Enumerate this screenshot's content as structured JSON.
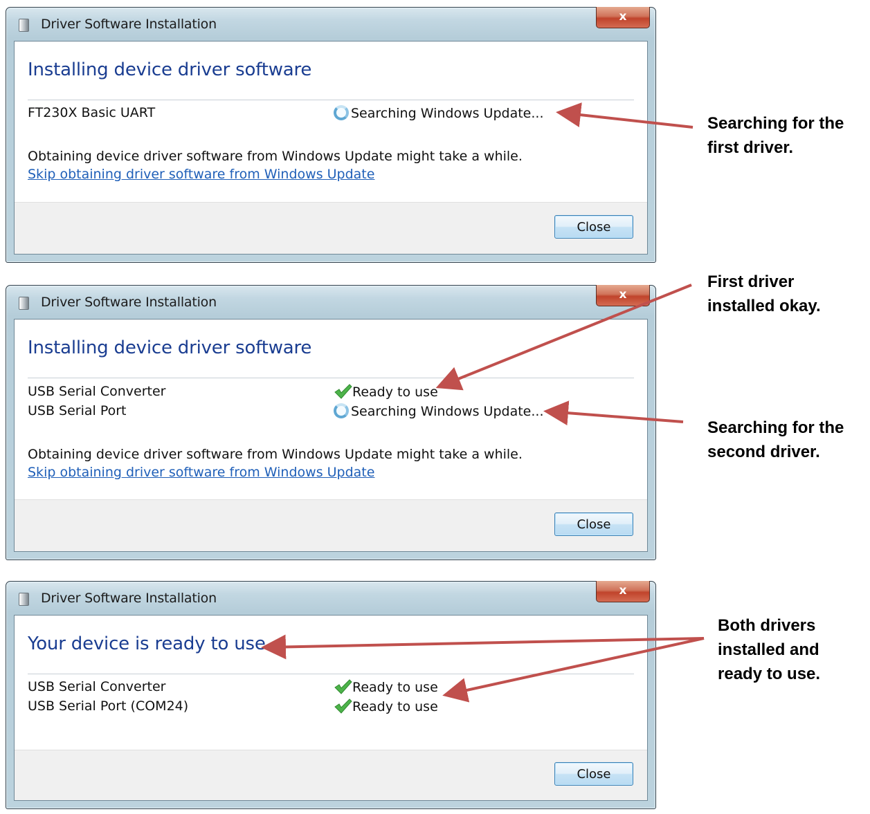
{
  "dialogs": [
    {
      "title": "Driver Software Installation",
      "close_glyph": "x",
      "heading": "Installing device driver software",
      "rows": [
        {
          "name": "FT230X Basic UART",
          "status": "Searching Windows Update...",
          "icon": "spinner-icon"
        }
      ],
      "note": "Obtaining device driver software from Windows Update might take a while.",
      "link": "Skip obtaining driver software from Windows Update",
      "close_button": "Close"
    },
    {
      "title": "Driver Software Installation",
      "close_glyph": "x",
      "heading": "Installing device driver software",
      "rows": [
        {
          "name": "USB Serial Converter",
          "status": "Ready to use",
          "icon": "checkmark-icon"
        },
        {
          "name": "USB Serial Port",
          "status": "Searching Windows Update...",
          "icon": "spinner-icon"
        }
      ],
      "note": "Obtaining device driver software from Windows Update might take a while.",
      "link": "Skip obtaining driver software from Windows Update",
      "close_button": "Close"
    },
    {
      "title": "Driver Software Installation",
      "close_glyph": "x",
      "heading": "Your device is ready to use",
      "rows": [
        {
          "name": "USB Serial Converter",
          "status": "Ready to use",
          "icon": "checkmark-icon"
        },
        {
          "name": "USB Serial Port (COM24)",
          "status": "Ready to use",
          "icon": "checkmark-icon"
        }
      ],
      "close_button": "Close"
    }
  ],
  "annotations": {
    "first": [
      "Searching for the",
      "first driver."
    ],
    "second": [
      "First driver",
      "installed okay."
    ],
    "third": [
      "Searching for the",
      "second driver."
    ],
    "fourth": [
      "Both drivers",
      "installed and",
      "ready to use."
    ]
  },
  "colors": {
    "arrow": "#c0504d",
    "heading": "#1a3d91",
    "link": "#1f5fb8"
  }
}
